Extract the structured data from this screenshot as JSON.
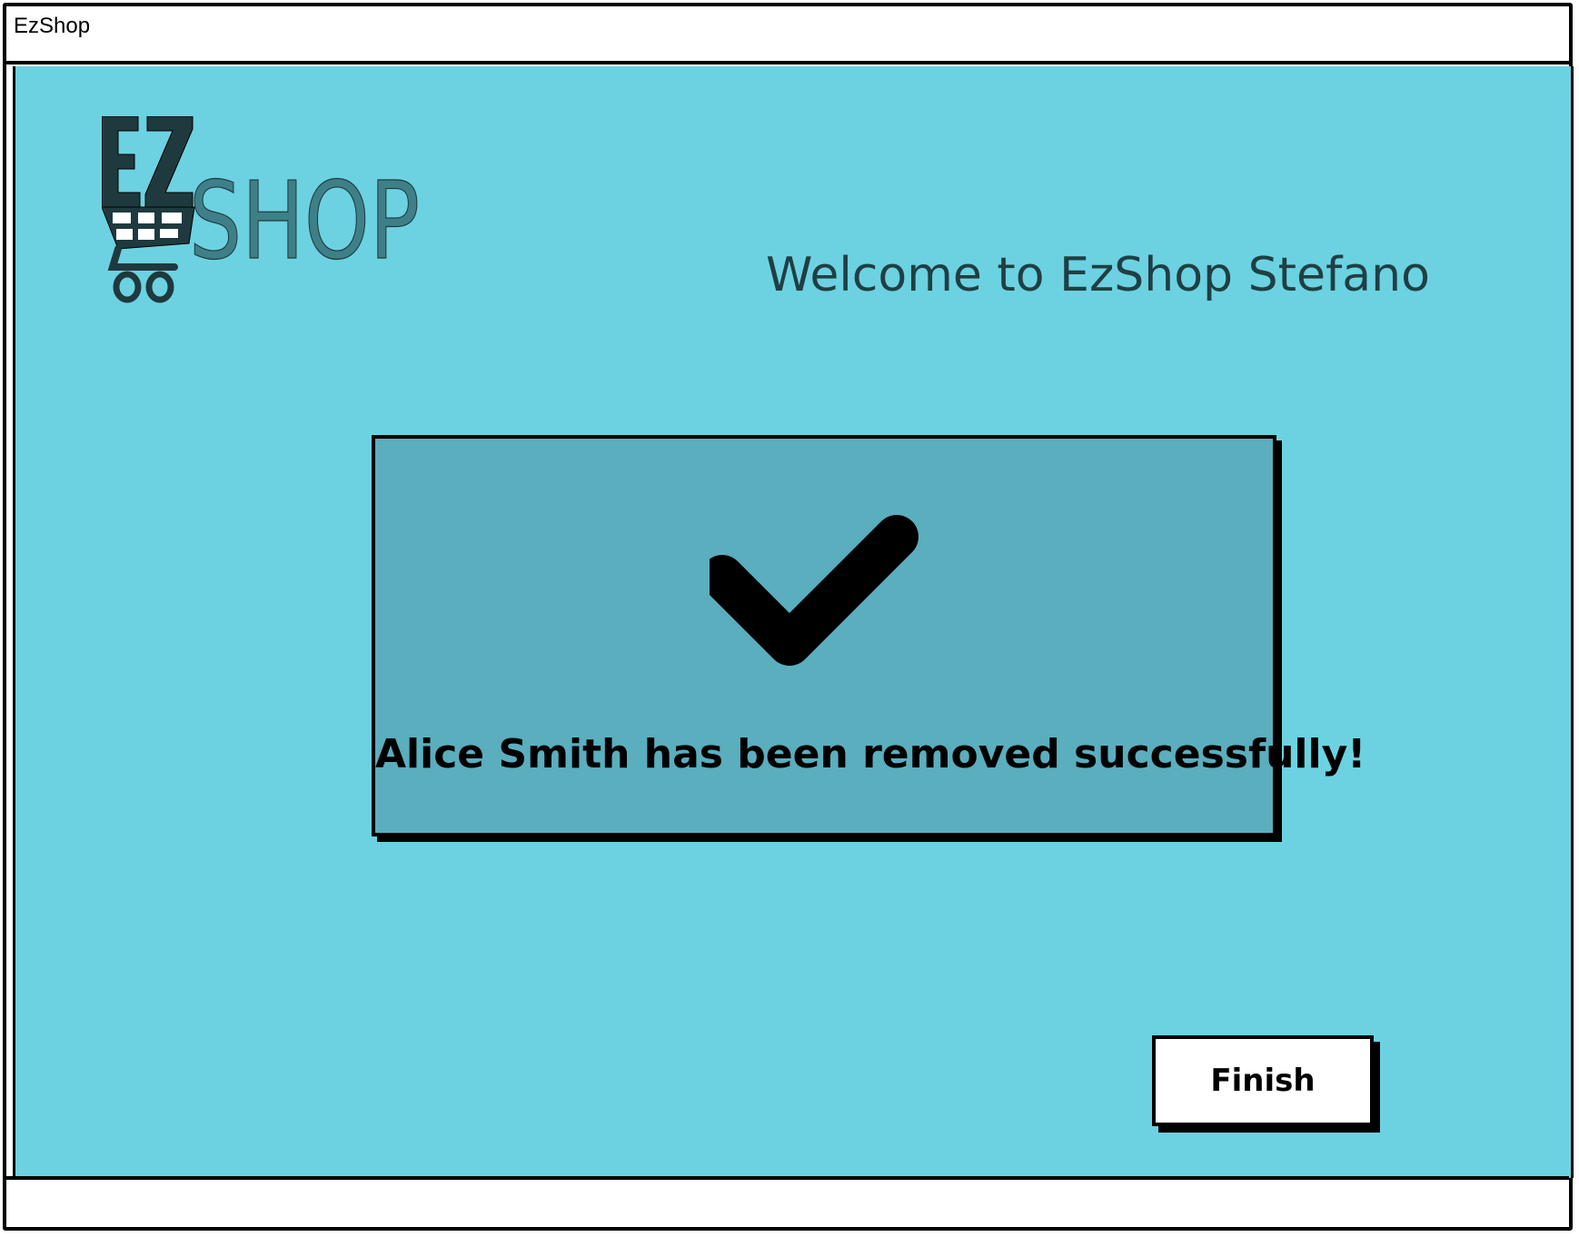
{
  "window": {
    "title": "EzShop"
  },
  "logo": {
    "ez": "EZ",
    "shop": "SHOP"
  },
  "header": {
    "welcome": "Welcome to EzShop Stefano"
  },
  "dialog": {
    "icon": "checkmark-icon",
    "message": "Alice Smith has been removed successfully!"
  },
  "actions": {
    "finish_label": "Finish"
  },
  "colors": {
    "background": "#6cd2e1",
    "dialog": "#5aaebd",
    "logo_dark": "#1f3a3f",
    "logo_light": "#3f7f88",
    "welcome_text": "#1f3f44"
  }
}
